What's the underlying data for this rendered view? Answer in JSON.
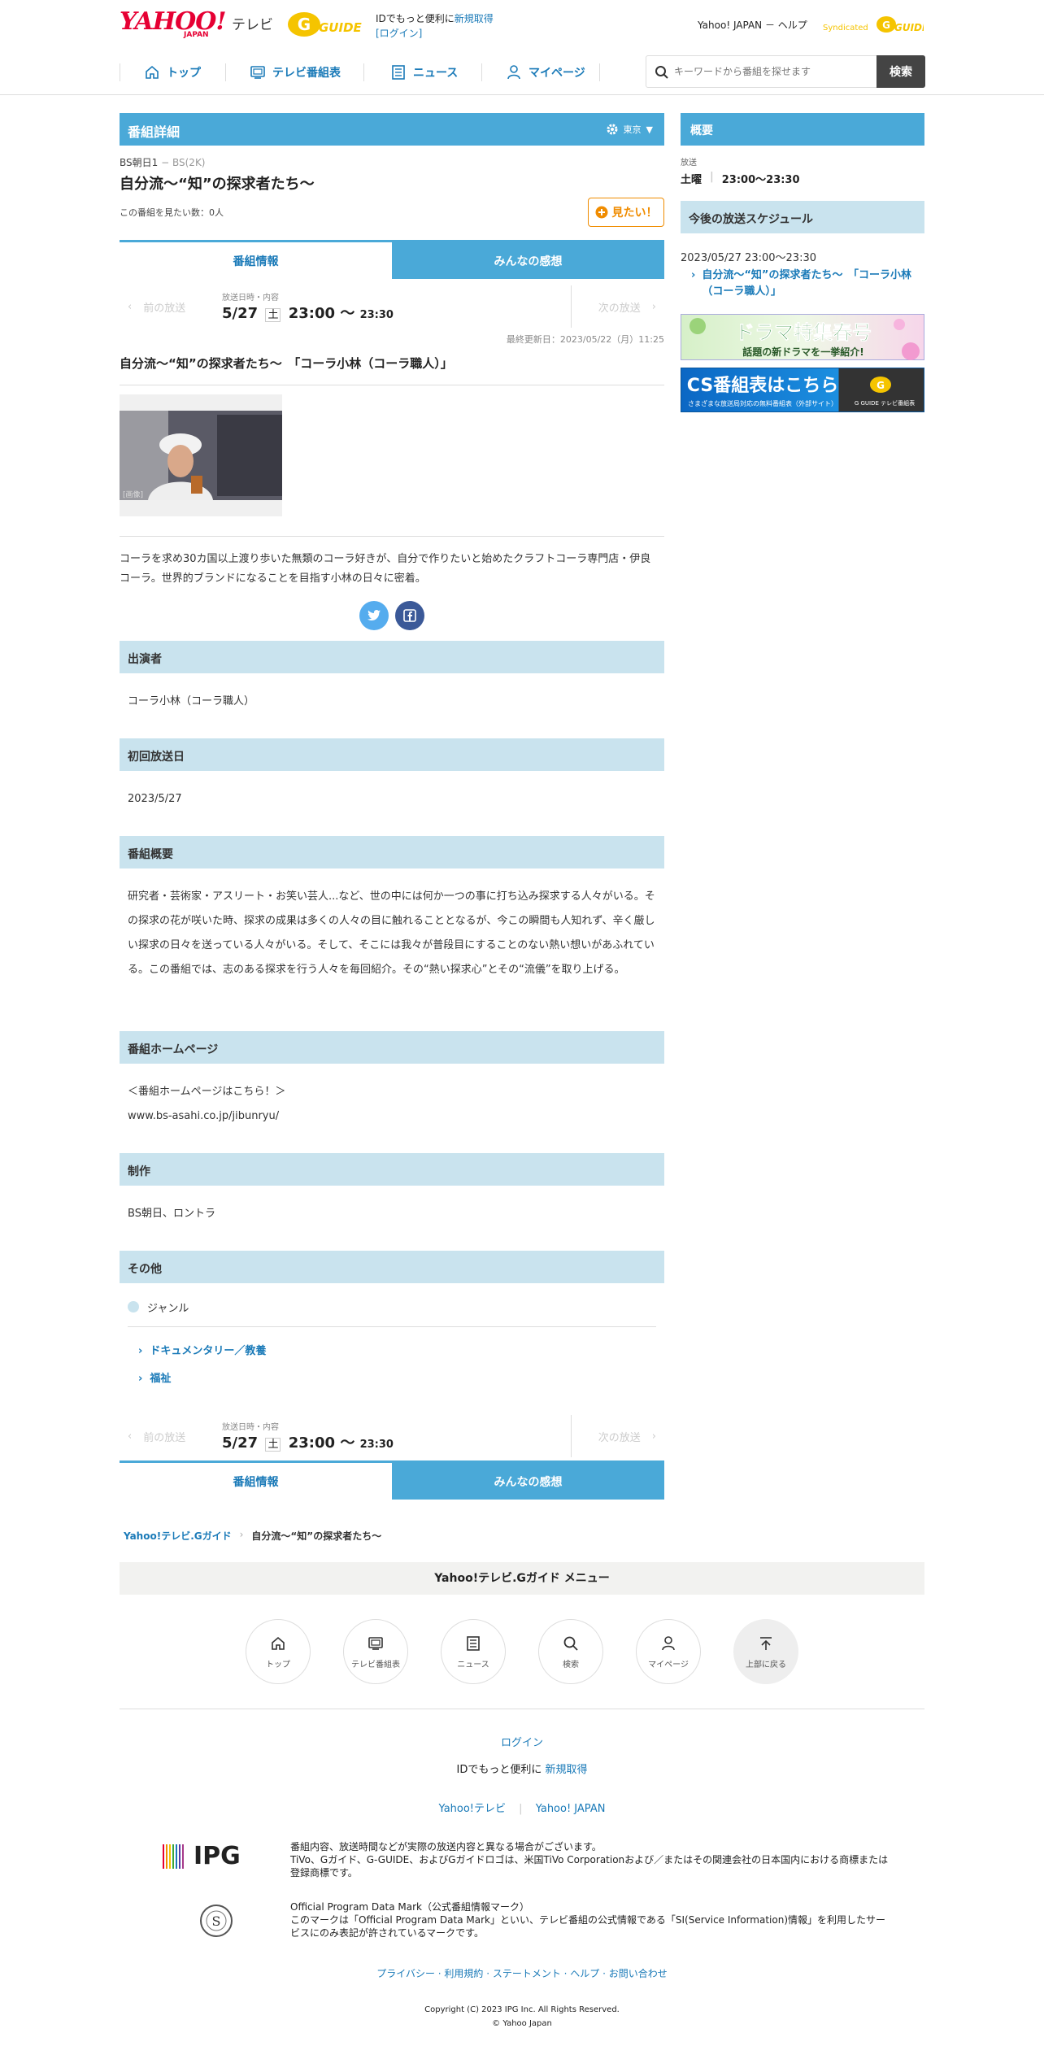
{
  "header": {
    "logo_yahoo": "YAHOO!",
    "logo_japan": "JAPAN",
    "logo_tv": "テレビ",
    "gguide_logo": "G GUIDE",
    "id_line1_prefix": "IDでもっと便利に",
    "id_line1_link": "新規取得",
    "id_line2": "[ログイン]",
    "top_links": "Yahoo! JAPAN － ヘルプ",
    "syndicated_logo": "Syndicated G GUIDE"
  },
  "nav": {
    "items": [
      {
        "label": "トップ",
        "icon": "home-icon"
      },
      {
        "label": "テレビ番組表",
        "icon": "tv-icon"
      },
      {
        "label": "ニュース",
        "icon": "news-icon"
      },
      {
        "label": "マイページ",
        "icon": "user-icon"
      }
    ],
    "search_placeholder": "キーワードから番組を探せます",
    "search_button": "検索"
  },
  "detail": {
    "header_title": "番組詳細",
    "region": "東京",
    "channel": "BS朝日1",
    "channel_sub": "BS(2K)",
    "program_title": "自分流〜“知”の探求者たち〜",
    "want_count_label": "この番組を見たい数：0人",
    "want_button": "見たい！",
    "tabs": [
      "番組情報",
      "みんなの感想"
    ],
    "prev": "前の放送",
    "next": "次の放送",
    "air_label": "放送日時・内容",
    "air_date": "5/27",
    "air_day": "土",
    "air_start": "23:00",
    "air_sep": "〜",
    "air_end": "23:30",
    "updated": "最終更新日：2023/05/22（月）11:25",
    "episode_title": "自分流〜“知”の探求者たち〜　「コーラ小林（コーラ職人）」",
    "image_caption": "[画像]",
    "description": "コーラを求め30カ国以上渡り歩いた無類のコーラ好きが、自分で作りたいと始めたクラフトコーラ専門店・伊良コーラ。世界的ブランドになることを目指す小林の日々に密着。",
    "share_twitter": "twitter-icon",
    "share_facebook": "facebook-icon"
  },
  "sections": {
    "cast_title": "出演者",
    "cast": "コーラ小林（コーラ職人）",
    "first_air_title": "初回放送日",
    "first_air": "2023/5/27",
    "summary_title": "番組概要",
    "summary": "研究者・芸術家・アスリート・お笑い芸人...など、世の中には何か一つの事に打ち込み探求する人々がいる。その探求の花が咲いた時、探求の成果は多くの人々の目に触れることとなるが、今この瞬間も人知れず、辛く厳しい探求の日々を送っている人々がいる。そして、そこには我々が普段目にすることのない熱い想いがあふれている。この番組では、志のある探求を行う人々を毎回紹介。その“熱い探求心”とその“流儀”を取り上げる。",
    "homepage_title": "番組ホームページ",
    "homepage_label": "＜番組ホームページはこちら！＞",
    "homepage_url": "www.bs-asahi.co.jp/jibunryu/",
    "production_title": "制作",
    "production": "BS朝日、ロントラ",
    "other_title": "その他",
    "genre_label": "ジャンル",
    "genres": [
      "ドキュメンタリー／教養",
      "福祉"
    ]
  },
  "breadcrumb": {
    "root": "Yahoo!テレビ.Gガイド",
    "current": "自分流〜“知”の探求者たち〜"
  },
  "sidebar": {
    "overview_title": "概要",
    "air_label": "放送",
    "air_day": "土曜",
    "air_time": "23:00～23:30",
    "schedule_title": "今後の放送スケジュール",
    "schedule_date": "2023/05/27 23:00～23:30",
    "schedule_link": "自分流〜“知”の探求者たち〜　「コーラ小林（コーラ職人）」",
    "banner1_main": "ドラマ特集春号",
    "banner1_sub": "話題の新ドラマを一挙紹介!",
    "banner2_main": "CS番組表はこちら",
    "banner2_sub": "さまざまな放送局対応の無料番組表（外部サイト）",
    "banner2_logo": "G GUIDE テレビ番組表"
  },
  "footer_menu": {
    "title": "Yahoo!テレビ.Gガイド メニュー",
    "items": [
      {
        "label": "トップ",
        "icon": "home-icon"
      },
      {
        "label": "テレビ番組表",
        "icon": "tv-icon"
      },
      {
        "label": "ニュース",
        "icon": "news-icon"
      },
      {
        "label": "検索",
        "icon": "search-icon"
      },
      {
        "label": "マイページ",
        "icon": "user-icon"
      },
      {
        "label": "上部に戻る",
        "icon": "back-to-top-icon"
      }
    ]
  },
  "footer": {
    "login": "ログイン",
    "id_prefix": "IDでもっと便利に",
    "id_link": "新規取得",
    "link1": "Yahoo!テレビ",
    "link2": "Yahoo! JAPAN",
    "ipg_logo": "IPG",
    "notice1": "番組内容、放送時間などが実際の放送内容と異なる場合がございます。",
    "notice2": "TiVo、Gガイド、G-GUIDE、およびGガイドロゴは、米国TiVo Corporationおよび／またはその関連会社の日本国内における商標または登録商標です。",
    "opdm_title": "Official Program Data Mark（公式番組情報マーク）",
    "opdm_text": "このマークは「Official Program Data Mark」といい、テレビ番組の公式情報である「SI(Service Information)情報」を利用したサービスにのみ表記が許されているマークです。",
    "legal_links": "プライバシー · 利用規約 · ステートメント · ヘルプ · お問い合わせ",
    "copyright1": "Copyright (C) 2023 IPG Inc. All Rights Reserved.",
    "copyright2": "© Yahoo Japan"
  },
  "colors": {
    "accent_blue": "#4aa9d8",
    "section_bg": "#c9e3ee",
    "link": "#1a7ab8",
    "brand_red": "#e60033",
    "want_orange": "#f08c00"
  }
}
